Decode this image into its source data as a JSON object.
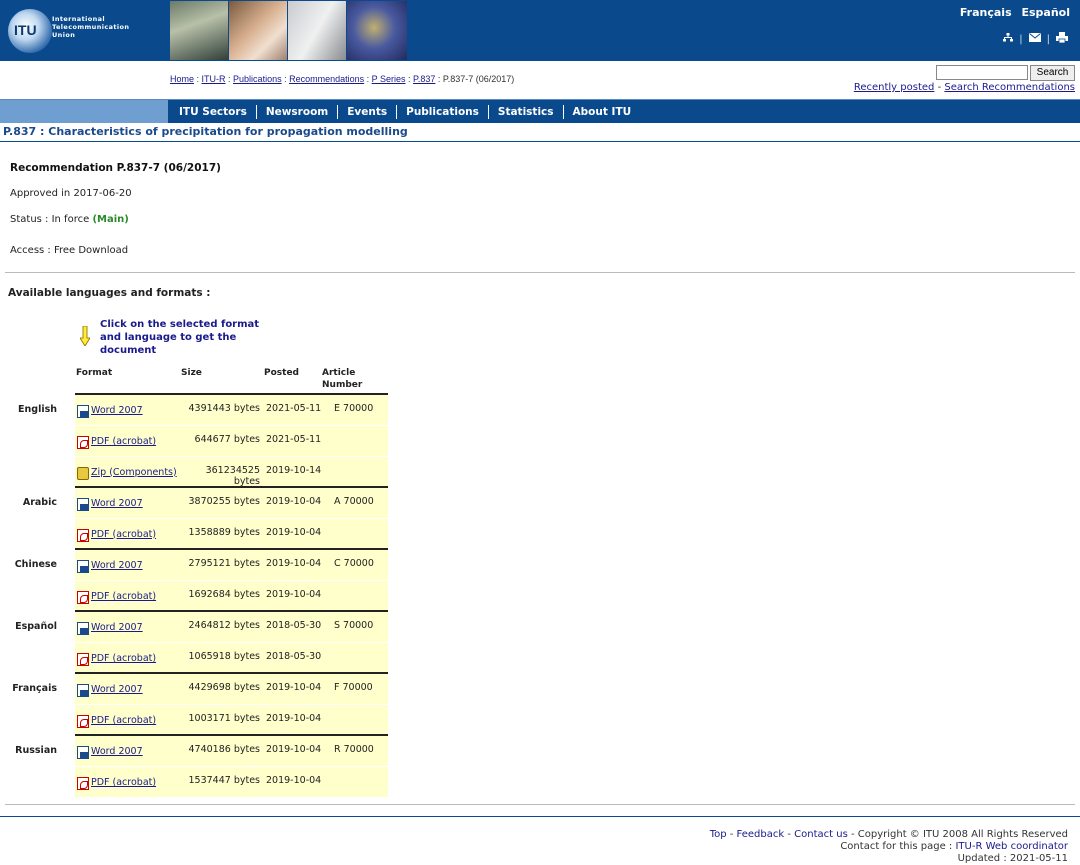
{
  "header": {
    "logo_lines": [
      "International",
      "Telecommunication",
      "Union"
    ],
    "logo_abbr": "ITU",
    "lang_links": [
      "Français",
      "Español"
    ],
    "tool_icons": [
      "sitemap-icon",
      "mail-icon",
      "print-icon"
    ]
  },
  "breadcrumb": {
    "items": [
      "Home",
      "ITU-R",
      "Publications",
      "Recommendations",
      "P Series",
      "P.837"
    ],
    "current": "P.837-7 (06/2017)"
  },
  "search": {
    "button": "Search",
    "recent": "Recently posted",
    "separator": "-",
    "search_recs": "Search Recommendations"
  },
  "nav": {
    "items": [
      "ITU Sectors",
      "Newsroom",
      "Events",
      "Publications",
      "Statistics",
      "About ITU"
    ]
  },
  "page": {
    "title": "P.837 : Characteristics of precipitation for propagation modelling",
    "rec_title": "Recommendation P.837-7 (06/2017)",
    "approved": "Approved in 2017-06-20",
    "status_label": "Status : In force",
    "status_main": "(Main)",
    "access": "Access : Free Download",
    "available": "Available languages and formats :",
    "hint": "Click on the selected format and language to get the document"
  },
  "table": {
    "headers": {
      "format": "Format",
      "size": "Size",
      "posted": "Posted",
      "article_line1": "Article",
      "article_line2": "Number"
    },
    "groups": [
      {
        "language": "English",
        "rows": [
          {
            "icon": "word-icon",
            "format": "Word 2007",
            "size": "4391443 bytes",
            "posted": "2021-05-11",
            "article": "E 70000"
          },
          {
            "icon": "pdf-icon",
            "format": "PDF (acrobat)",
            "size": "644677 bytes",
            "posted": "2021-05-11",
            "article": ""
          },
          {
            "icon": "zip-icon",
            "format": "Zip (Components)",
            "size": "361234525 bytes",
            "posted": "2019-10-14",
            "article": ""
          }
        ]
      },
      {
        "language": "Arabic",
        "rows": [
          {
            "icon": "word-icon",
            "format": "Word 2007",
            "size": "3870255 bytes",
            "posted": "2019-10-04",
            "article": "A 70000"
          },
          {
            "icon": "pdf-icon",
            "format": "PDF (acrobat)",
            "size": "1358889 bytes",
            "posted": "2019-10-04",
            "article": ""
          }
        ]
      },
      {
        "language": "Chinese",
        "rows": [
          {
            "icon": "word-icon",
            "format": "Word 2007",
            "size": "2795121 bytes",
            "posted": "2019-10-04",
            "article": "C 70000"
          },
          {
            "icon": "pdf-icon",
            "format": "PDF (acrobat)",
            "size": "1692684 bytes",
            "posted": "2019-10-04",
            "article": ""
          }
        ]
      },
      {
        "language": "Español",
        "rows": [
          {
            "icon": "word-icon",
            "format": "Word 2007",
            "size": "2464812 bytes",
            "posted": "2018-05-30",
            "article": "S 70000"
          },
          {
            "icon": "pdf-icon",
            "format": "PDF (acrobat)",
            "size": "1065918 bytes",
            "posted": "2018-05-30",
            "article": ""
          }
        ]
      },
      {
        "language": "Français",
        "rows": [
          {
            "icon": "word-icon",
            "format": "Word 2007",
            "size": "4429698 bytes",
            "posted": "2019-10-04",
            "article": "F 70000"
          },
          {
            "icon": "pdf-icon",
            "format": "PDF (acrobat)",
            "size": "1003171 bytes",
            "posted": "2019-10-04",
            "article": ""
          }
        ]
      },
      {
        "language": "Russian",
        "rows": [
          {
            "icon": "word-icon",
            "format": "Word 2007",
            "size": "4740186 bytes",
            "posted": "2019-10-04",
            "article": "R 70000"
          },
          {
            "icon": "pdf-icon",
            "format": "PDF (acrobat)",
            "size": "1537447 bytes",
            "posted": "2019-10-04",
            "article": ""
          }
        ]
      }
    ]
  },
  "footer": {
    "top": "Top",
    "feedback": "Feedback",
    "contact": "Contact us",
    "copyright": "Copyright © ITU 2008 All Rights Reserved",
    "contact_page_label": "Contact for this page :",
    "contact_page": "ITU-R Web coordinator",
    "updated": "Updated : 2021-05-11"
  },
  "colors": {
    "header_bg": "#0a4a8c",
    "cell_bg": "#ffffcc",
    "link": "#1a1a8c",
    "main_status": "#2a8a2a"
  }
}
